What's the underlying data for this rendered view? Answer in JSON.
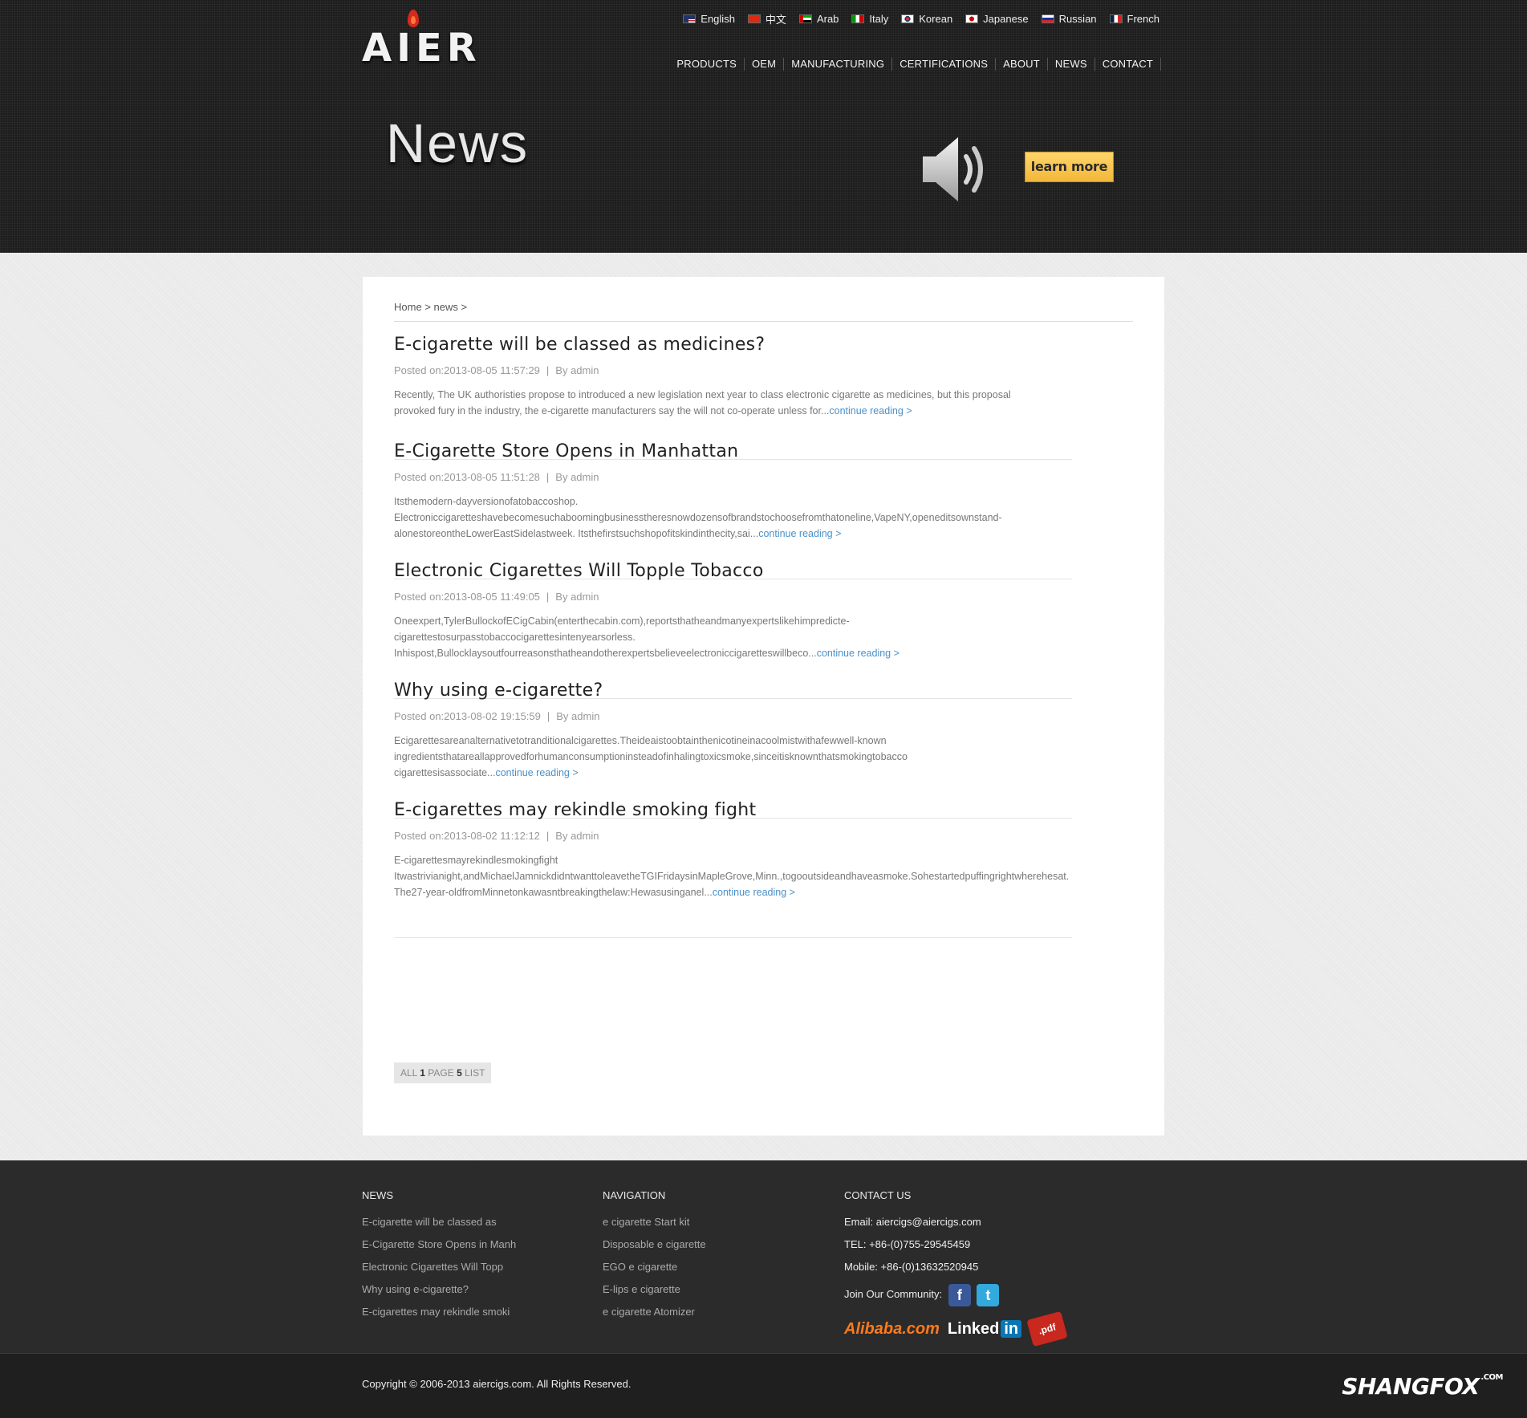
{
  "brand": {
    "logo_text": "AIER"
  },
  "languages": [
    {
      "label": "English",
      "flag": "us"
    },
    {
      "label": "中文",
      "flag": "cn"
    },
    {
      "label": "Arab",
      "flag": "ae"
    },
    {
      "label": "Italy",
      "flag": "it"
    },
    {
      "label": "Korean",
      "flag": "kr"
    },
    {
      "label": "Japanese",
      "flag": "jp"
    },
    {
      "label": "Russian",
      "flag": "ru"
    },
    {
      "label": "French",
      "flag": "fr"
    }
  ],
  "nav": [
    "PRODUCTS",
    "OEM",
    "MANUFACTURING",
    "CERTIFICATIONS",
    "ABOUT",
    "NEWS",
    "CONTACT"
  ],
  "hero": {
    "title": "News",
    "learn_more": "learn more"
  },
  "breadcrumb": {
    "home": "Home",
    "current": "news",
    "sep": ">"
  },
  "posts": [
    {
      "title": "E-cigarette will be classed as medicines?",
      "posted": "Posted on:2013-08-05 11:57:29",
      "author": "By admin",
      "excerpt": [
        "Recently, The UK authoristies propose to introduced a new legislation next year to class electronic cigarette as medicines, but this proposal",
        "provoked fury in the industry, the e-cigarette manufacturers say the will not co-operate unless for..."
      ],
      "more": "continue reading >"
    },
    {
      "title": "E-Cigarette Store Opens in Manhattan",
      "posted": "Posted on:2013-08-05 11:51:28",
      "author": "By admin",
      "excerpt": [
        "Itsthemodern-dayversionofatobaccoshop.",
        "Electroniccigaretteshavebecomesuchaboomingbusinesstheresnowdozensofbrandstochoosefromthatoneline,VapeNY,openeditsownstand-",
        "alonestoreontheLowerEastSidelastweek. Itsthefirstsuchshopofitskindinthecity,sai..."
      ],
      "more": "continue reading >"
    },
    {
      "title": "Electronic Cigarettes Will Topple Tobacco",
      "posted": "Posted on:2013-08-05 11:49:05",
      "author": "By admin",
      "excerpt": [
        "Oneexpert,TylerBullockofECigCabin(enterthecabin.com),reportsthatheandmanyexpertslikehimpredicte-",
        "cigarettestosurpasstobaccocigarettesintenyearsorless.",
        "Inhispost,Bullocklaysoutfourreasonsthatheandotherexpertsbelieveelectroniccigaretteswillbeco..."
      ],
      "more": "continue reading >"
    },
    {
      "title": "Why using e-cigarette?",
      "posted": "Posted on:2013-08-02 19:15:59",
      "author": "By admin",
      "excerpt": [
        "Ecigarettesareanalternativetotranditionalcigarettes.Theideaistoobtainthenicotineinacoolmistwithafewwell-known",
        "ingredientsthatareallapprovedforhumanconsumptioninsteadofinhalingtoxicsmoke,sinceitisknownthatsmokingtobacco",
        "cigarettesisassociate..."
      ],
      "more": "continue reading >"
    },
    {
      "title": "E-cigarettes may rekindle smoking fight",
      "posted": "Posted on:2013-08-02 11:12:12",
      "author": "By admin",
      "excerpt": [
        "E-cigarettesmayrekindlesmokingfight",
        "Itwastrivianight,andMichaelJamnickdidntwanttoleavetheTGIFridaysinMapleGrove,Minn.,togooutsideandhaveasmoke.Sohestartedpuffingrightwherehesat.",
        "The27-year-oldfromMinnetonkawasntbreakingthelaw:Hewasusinganel..."
      ],
      "more": "continue reading >"
    }
  ],
  "pager": {
    "all": "ALL",
    "pages": "1",
    "page": "PAGE",
    "count": "5",
    "list": "LIST"
  },
  "footer": {
    "news": {
      "heading": "NEWS",
      "items": [
        "E-cigarette will be classed as",
        "E-Cigarette Store Opens in Manh",
        "Electronic Cigarettes Will Topp",
        "Why using e-cigarette?",
        "E-cigarettes may rekindle smoki"
      ]
    },
    "navigation": {
      "heading": "NAVIGATION",
      "items": [
        "e cigarette Start kit",
        "Disposable e cigarette",
        "EGO e cigarette",
        "E-lips e cigarette",
        "e cigarette Atomizer"
      ]
    },
    "contact": {
      "heading": "CONTACT US",
      "email": "Email: aiercigs@aiercigs.com",
      "tel": "TEL: +86-(0)755-29545459",
      "mobile": "Mobile: +86-(0)13632520945",
      "community": "Join Our Community:",
      "facebook": "f",
      "twitter": "t",
      "alibaba": "Alibaba.com",
      "linkedin": "Linked",
      "linkedin_in": "in",
      "pdf": ".pdf"
    },
    "copyright": "Copyright © 2006-2013 aiercigs.com. All Rights Reserved.",
    "badge": "SHANGFOX",
    "badge_suffix": ".COM"
  },
  "colors": {
    "accent_link": "#4a90c8",
    "learn_more_bg": "#f6c24a",
    "header_bg": "#1d1d1d",
    "footer_bg": "#2b2b2b"
  }
}
